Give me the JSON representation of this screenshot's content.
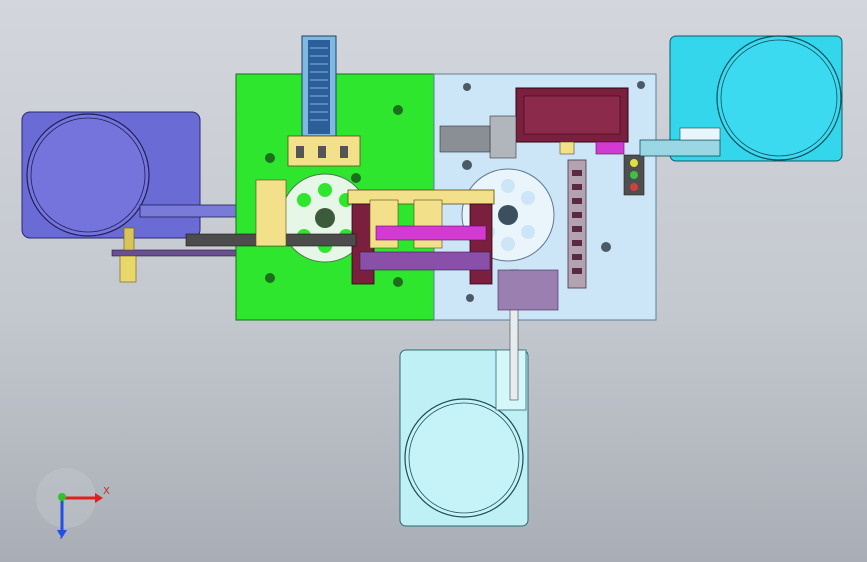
{
  "viewport": {
    "background_top": "#d3d6dc",
    "background_bottom": "#a9adb5"
  },
  "colors": {
    "left_plate": "#2fe62f",
    "right_plate": "#cde6f7",
    "left_feeder": "#6b6bd6",
    "top_right_feeder": "#34d6ec",
    "bottom_feeder": "#bff0f5",
    "maroon": "#7a1f3d",
    "yellow": "#f3e08a",
    "magenta": "#d23ad2",
    "gray_part": "#8a8f95"
  },
  "triad": {
    "x_label": "X",
    "y_label": "Y",
    "x_color": "#e02020",
    "y_color": "#2050e0",
    "origin_color": "#30c030",
    "icon": "coordinate-triad-icon"
  }
}
